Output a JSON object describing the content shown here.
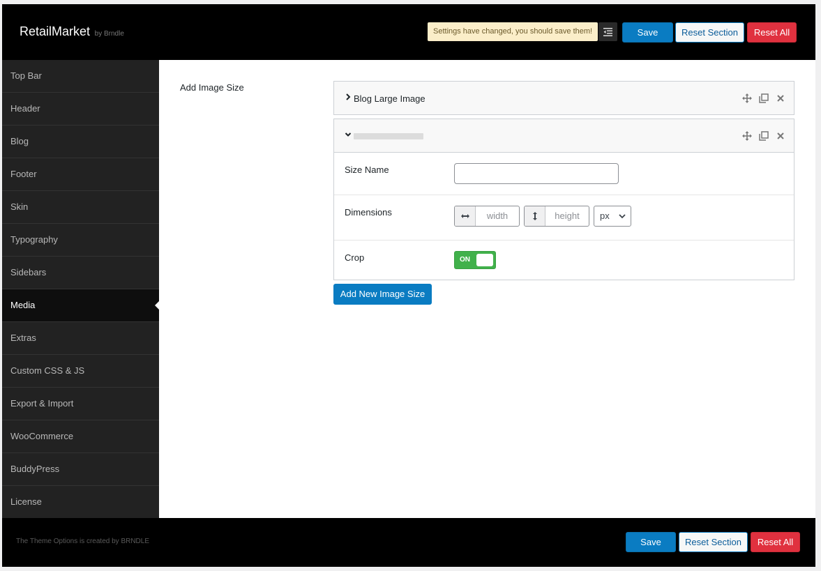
{
  "header": {
    "brand_name": "RetailMarket",
    "brand_by": "by Brndle",
    "notice": "Settings have changed, you should save them!",
    "save_label": "Save",
    "reset_section_label": "Reset Section",
    "reset_all_label": "Reset All"
  },
  "sidebar": {
    "items": [
      {
        "label": "Top Bar"
      },
      {
        "label": "Header"
      },
      {
        "label": "Blog"
      },
      {
        "label": "Footer"
      },
      {
        "label": "Skin"
      },
      {
        "label": "Typography"
      },
      {
        "label": "Sidebars"
      },
      {
        "label": "Media"
      },
      {
        "label": "Extras"
      },
      {
        "label": "Custom CSS & JS"
      },
      {
        "label": "Export & Import"
      },
      {
        "label": "WooCommerce"
      },
      {
        "label": "BuddyPress"
      },
      {
        "label": "License"
      }
    ],
    "active": "Media"
  },
  "main": {
    "field_title": "Add Image Size",
    "groups": [
      {
        "title": "Blog Large Image",
        "expanded": false
      },
      {
        "title": "",
        "expanded": true,
        "fields": {
          "size_name_label": "Size Name",
          "size_name_value": "",
          "dimensions_label": "Dimensions",
          "width_placeholder": "width",
          "height_placeholder": "height",
          "unit_value": "px",
          "crop_label": "Crop",
          "crop_state": "ON"
        }
      }
    ],
    "add_button_label": "Add New Image Size"
  },
  "footer": {
    "credit": "The Theme Options is created by BRNDLE",
    "save_label": "Save",
    "reset_section_label": "Reset Section",
    "reset_all_label": "Reset All"
  },
  "colors": {
    "primary": "#0a7cc2",
    "danger": "#e0313f",
    "toggle_on": "#41b14b",
    "notice_bg": "#fbeec9"
  }
}
